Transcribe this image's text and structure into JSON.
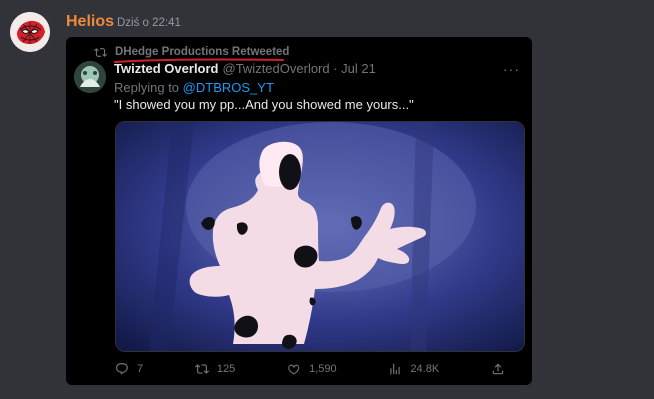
{
  "message": {
    "author": "Helios",
    "timestamp": "Dziś o 22:41"
  },
  "tweet": {
    "retweeted_by": "DHedge Productions Retweeted",
    "display_name": "Twizted Overlord",
    "handle_date": "@TwiztedOverlord · Jul 21",
    "reply_prefix": "Replying to",
    "reply_to": "@DTBROS_YT",
    "text": "\"I showed you my pp...And you showed me yours...\"",
    "more_icon": "···",
    "stats": {
      "replies": "7",
      "retweets": "125",
      "likes": "1,590",
      "views": "24.8K"
    }
  },
  "colors": {
    "author": "#f0883e",
    "background": "#313338",
    "embed": "#000000",
    "mention": "#1d9bf0",
    "muted": "#71767b",
    "underline": "#d3202a"
  },
  "icons": [
    "discord-avatar-spiderman-icon",
    "retweet-icon",
    "reply-icon",
    "like-icon",
    "views-icon",
    "share-icon",
    "more-icon"
  ]
}
